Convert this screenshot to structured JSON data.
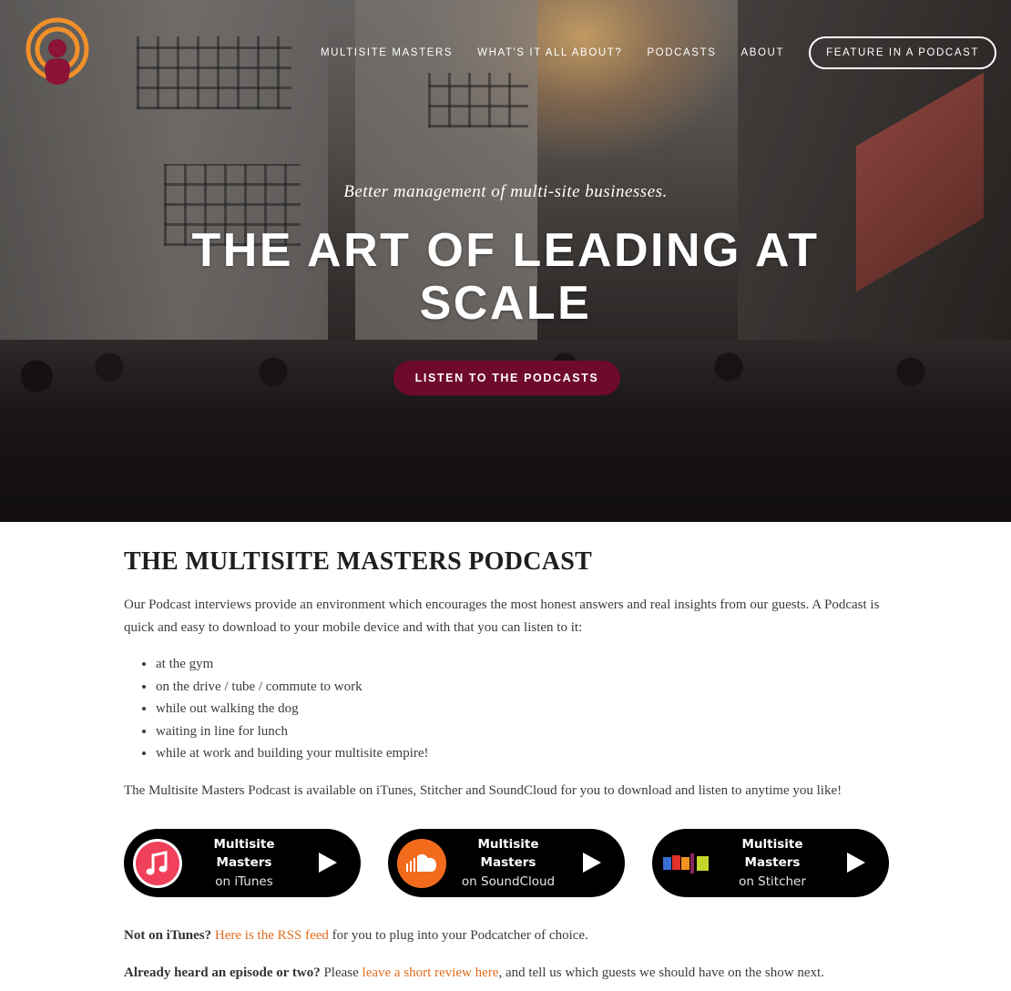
{
  "nav": {
    "items": [
      "MULTISITE MASTERS",
      "WHAT'S IT ALL ABOUT?",
      "PODCASTS",
      "ABOUT"
    ],
    "feature_button": "FEATURE IN A PODCAST"
  },
  "hero": {
    "subtitle": "Better management of multi-site businesses.",
    "title": "THE ART OF LEADING AT SCALE",
    "cta": "LISTEN TO THE PODCASTS"
  },
  "content": {
    "heading": "THE MULTISITE MASTERS PODCAST",
    "intro": "Our Podcast interviews provide an environment which encourages the most honest answers and real insights from our guests. A Podcast is quick and easy to download to your mobile device and with that you can listen to it:",
    "bullets": [
      "at the gym",
      "on the drive / tube / commute to work",
      "while out walking the dog",
      "waiting in line for lunch",
      "while at work and building your multisite empire!"
    ],
    "availability": "The Multisite Masters Podcast is available on iTunes, Stitcher and SoundCloud for you to download and listen to anytime you like!",
    "rss_bold": "Not on iTunes?",
    "rss_link": "Here is the RSS feed",
    "rss_rest": " for you to plug into your Podcatcher of choice.",
    "review_bold": "Already heard an episode or two?",
    "review_pre": " Please ",
    "review_link": "leave a short review here",
    "review_rest": ", and tell us which guests we should have on the show next."
  },
  "badges": [
    {
      "name": "Multisite Masters",
      "platform": "on iTunes",
      "icon": "itunes-icon"
    },
    {
      "name": "Multisite Masters",
      "platform": "on SoundCloud",
      "icon": "soundcloud-icon"
    },
    {
      "name": "Multisite Masters",
      "platform": "on Stitcher",
      "icon": "stitcher-icon"
    }
  ],
  "colors": {
    "accent_orange": "#e06d1f",
    "cta_burgundy": "#6e0a2a",
    "logo_orange": "#f0902a",
    "logo_maroon": "#8c1238"
  }
}
